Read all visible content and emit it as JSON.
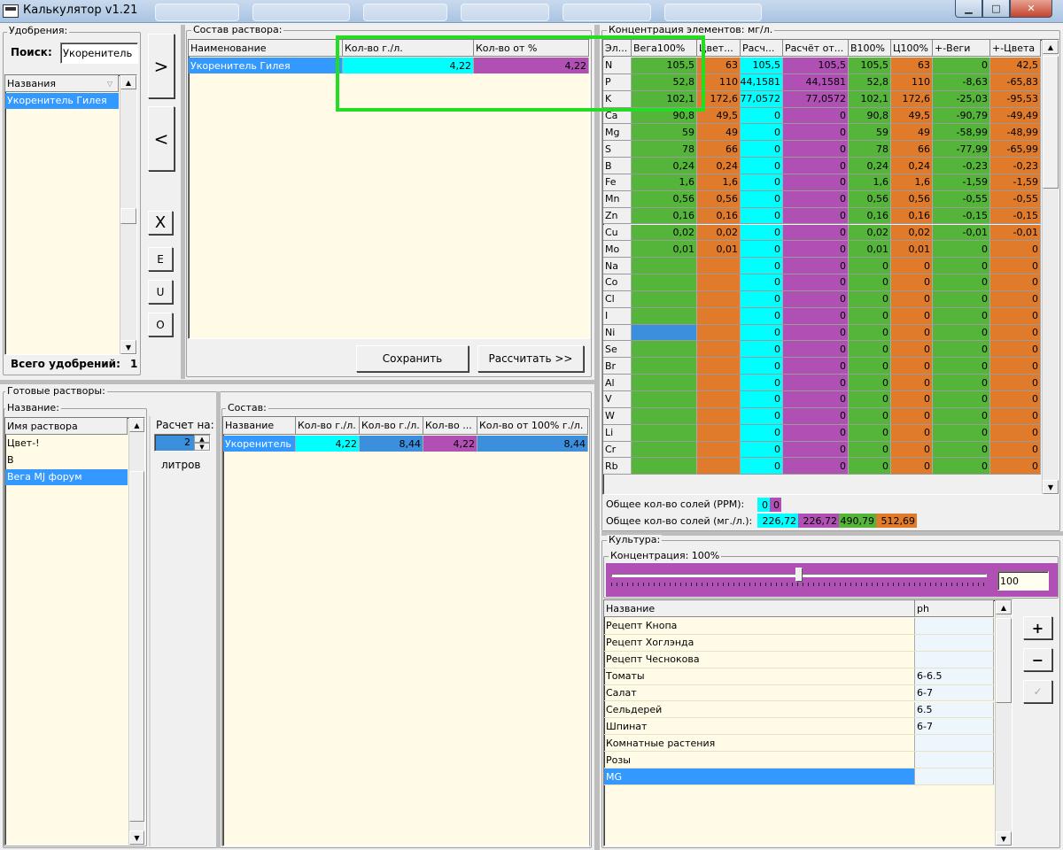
{
  "app": {
    "title": "Калькулятор v1.21"
  },
  "colors": {
    "cyan": "#00ffff",
    "magenta": "#b04fb4",
    "green": "#55b43a",
    "orange": "#e07b2b",
    "blue": "#3b8fdd",
    "cream": "#fffbe6",
    "selection": "#3399ff",
    "highlight": "#22dd22"
  },
  "fert": {
    "group": "Удобрения:",
    "search_label": "Поиск:",
    "search_value": "Укоренитель",
    "col_header": "Названия",
    "items": [
      "Укоренитель Гилея"
    ],
    "total_label": "Всего удобрений:",
    "total_value": "1"
  },
  "move": {
    "add": ">",
    "remove": "<",
    "clear": "X",
    "e": "E",
    "u": "U",
    "o": "O"
  },
  "solution": {
    "group": "Состав раствора:",
    "headers": [
      "Наименование",
      "Кол-во г./л.",
      "Кол-во от %"
    ],
    "rows": [
      {
        "name": "Укоренитель Гилея",
        "gl": "4,22",
        "pct": "4,22"
      }
    ],
    "save": "Сохранить",
    "calc": "Рассчитать >>"
  },
  "ready": {
    "group": "Готовые растворы:",
    "name_label": "Название:",
    "col_header": "Имя раствора",
    "items": [
      "Цвет-!",
      "B",
      "Вега MJ форум"
    ],
    "calc_label": "Расчет на:",
    "liters_value": "2",
    "liters_label": "литров"
  },
  "composition": {
    "group": "Состав:",
    "headers": [
      "Название",
      "Кол-во г./л.",
      "Кол-во г./л.",
      "Кол-во ...",
      "Кол-во от 100% г./л."
    ],
    "rows": [
      {
        "name": "Укоренитель Гилея",
        "v1": "4,22",
        "v2": "8,44",
        "v3": "4,22",
        "v4": "8,44"
      }
    ]
  },
  "conc": {
    "group": "Концентрация элементов: мг/л.",
    "headers": [
      "Эл...",
      "Вега100%",
      "Цвет...",
      "Расч...",
      "Расчёт от...",
      "В100%",
      "Ц100%",
      "+-Веги",
      "+-Цвета"
    ],
    "rows": [
      [
        "N",
        "105,5",
        "63",
        "105,5",
        "105,5",
        "105,5",
        "63",
        "0",
        "42,5"
      ],
      [
        "P",
        "52,8",
        "110",
        "44,1581",
        "44,1581",
        "52,8",
        "110",
        "-8,63",
        "-65,83"
      ],
      [
        "K",
        "102,1",
        "172,6",
        "77,0572",
        "77,0572",
        "102,1",
        "172,6",
        "-25,03",
        "-95,53"
      ],
      [
        "Ca",
        "90,8",
        "49,5",
        "0",
        "0",
        "90,8",
        "49,5",
        "-90,79",
        "-49,49"
      ],
      [
        "Mg",
        "59",
        "49",
        "0",
        "0",
        "59",
        "49",
        "-58,99",
        "-48,99"
      ],
      [
        "S",
        "78",
        "66",
        "0",
        "0",
        "78",
        "66",
        "-77,99",
        "-65,99"
      ],
      [
        "B",
        "0,24",
        "0,24",
        "0",
        "0",
        "0,24",
        "0,24",
        "-0,23",
        "-0,23"
      ],
      [
        "Fe",
        "1,6",
        "1,6",
        "0",
        "0",
        "1,6",
        "1,6",
        "-1,59",
        "-1,59"
      ],
      [
        "Mn",
        "0,56",
        "0,56",
        "0",
        "0",
        "0,56",
        "0,56",
        "-0,55",
        "-0,55"
      ],
      [
        "Zn",
        "0,16",
        "0,16",
        "0",
        "0",
        "0,16",
        "0,16",
        "-0,15",
        "-0,15"
      ],
      [
        "Cu",
        "0,02",
        "0,02",
        "0",
        "0",
        "0,02",
        "0,02",
        "-0,01",
        "-0,01"
      ],
      [
        "Mo",
        "0,01",
        "0,01",
        "0",
        "0",
        "0,01",
        "0,01",
        "0",
        "0"
      ],
      [
        "Na",
        "",
        "",
        "0",
        "0",
        "0",
        "0",
        "0",
        "0"
      ],
      [
        "Co",
        "",
        "",
        "0",
        "0",
        "0",
        "0",
        "0",
        "0"
      ],
      [
        "Cl",
        "",
        "",
        "0",
        "0",
        "0",
        "0",
        "0",
        "0"
      ],
      [
        "I",
        "",
        "",
        "0",
        "0",
        "0",
        "0",
        "0",
        "0"
      ],
      [
        "Ni",
        "",
        "",
        "0",
        "0",
        "0",
        "0",
        "0",
        "0"
      ],
      [
        "Se",
        "",
        "",
        "0",
        "0",
        "0",
        "0",
        "0",
        "0"
      ],
      [
        "Br",
        "",
        "",
        "0",
        "0",
        "0",
        "0",
        "0",
        "0"
      ],
      [
        "Al",
        "",
        "",
        "0",
        "0",
        "0",
        "0",
        "0",
        "0"
      ],
      [
        "V",
        "",
        "",
        "0",
        "0",
        "0",
        "0",
        "0",
        "0"
      ],
      [
        "W",
        "",
        "",
        "0",
        "0",
        "0",
        "0",
        "0",
        "0"
      ],
      [
        "Li",
        "",
        "",
        "0",
        "0",
        "0",
        "0",
        "0",
        "0"
      ],
      [
        "Cr",
        "",
        "",
        "0",
        "0",
        "0",
        "0",
        "0",
        "0"
      ],
      [
        "Rb",
        "",
        "",
        "0",
        "0",
        "0",
        "0",
        "0",
        "0"
      ]
    ],
    "ppm_label": "Общее кол-во солей (PPM):",
    "ppm_values": [
      "0",
      "0"
    ],
    "mgl_label": "Общее кол-во солей (мг./л.):",
    "mgl_values": [
      "226,72",
      "226,72",
      "490,79",
      "512,69"
    ]
  },
  "culture": {
    "group": "Культура:",
    "conc_label": "Концентрация: 100%",
    "slider_value": 0.5,
    "conc_value": "100",
    "headers": [
      "Название",
      "ph"
    ],
    "rows": [
      {
        "name": "Рецепт Кнопа",
        "ph": ""
      },
      {
        "name": "Рецепт Хоглэнда",
        "ph": ""
      },
      {
        "name": "Рецепт Чеснокова",
        "ph": ""
      },
      {
        "name": "Томаты",
        "ph": "6-6.5"
      },
      {
        "name": "Салат",
        "ph": "6-7"
      },
      {
        "name": "Сельдерей",
        "ph": "6.5"
      },
      {
        "name": "Шпинат",
        "ph": "6-7"
      },
      {
        "name": "Комнатные растения",
        "ph": ""
      },
      {
        "name": "Розы",
        "ph": ""
      },
      {
        "name": "MG",
        "ph": ""
      }
    ],
    "plus": "+",
    "minus": "−",
    "edit_icon": "check-icon"
  }
}
